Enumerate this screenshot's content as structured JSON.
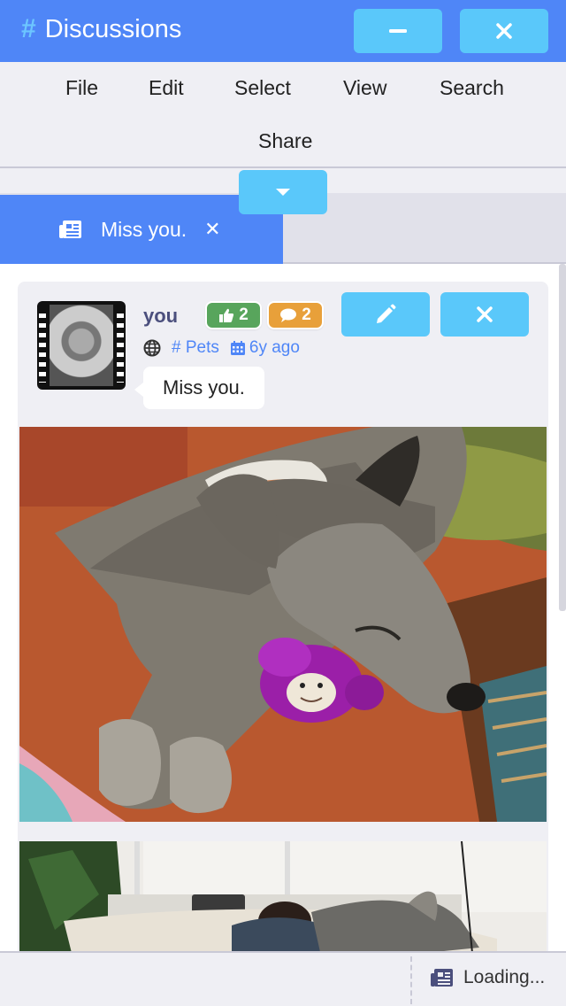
{
  "window": {
    "title": "Discussions",
    "title_icon": "hash-icon",
    "minimize_icon": "minus-icon",
    "close_icon": "close-icon"
  },
  "menu": {
    "items": [
      "File",
      "Edit",
      "Select",
      "View",
      "Search",
      "Share"
    ],
    "collapse_icon": "caret-down-icon"
  },
  "tabs": [
    {
      "label": "Miss you.",
      "icon": "newspaper-icon",
      "active": true
    }
  ],
  "post": {
    "author": "you",
    "likes": "2",
    "comments": "2",
    "visibility_icon": "globe-icon",
    "channel": "Pets",
    "time": "6y ago",
    "message": "Miss you.",
    "edit_icon": "pencil-icon",
    "delete_icon": "close-icon"
  },
  "status": {
    "text": "Loading...",
    "icon": "newspaper-icon"
  },
  "colors": {
    "primary": "#4f86f7",
    "button": "#5ac8fa",
    "likes": "#58a55c",
    "comments": "#e8a03a"
  }
}
